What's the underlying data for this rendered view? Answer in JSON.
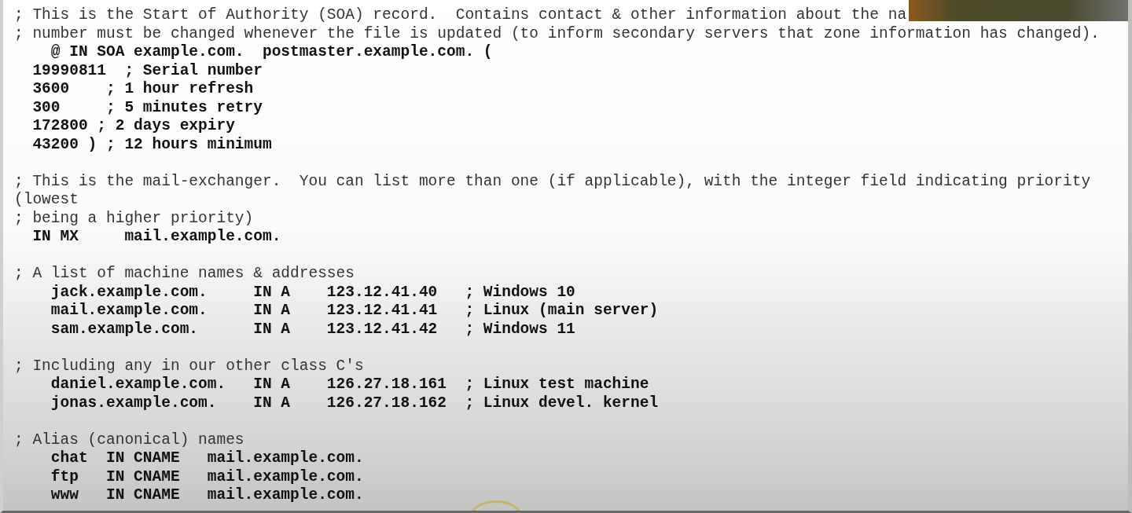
{
  "document": {
    "blocks": [
      {
        "lines": [
          {
            "kind": "comment",
            "text": "; This is the Start of Authority (SOA) record.  Contains contact & other information about the na"
          },
          {
            "kind": "comment",
            "text": "; number must be changed whenever the file is updated (to inform secondary servers that zone information has changed)."
          },
          {
            "kind": "record",
            "text": "    @ IN SOA example.com.  postmaster.example.com. ("
          },
          {
            "kind": "record",
            "text": "  19990811  ; Serial number"
          },
          {
            "kind": "record",
            "text": "  3600    ; 1 hour refresh"
          },
          {
            "kind": "record",
            "text": "  300     ; 5 minutes retry"
          },
          {
            "kind": "record",
            "text": "  172800 ; 2 days expiry"
          },
          {
            "kind": "record",
            "text": "  43200 ) ; 12 hours minimum"
          }
        ]
      },
      {
        "lines": [
          {
            "kind": "comment",
            "text": "; This is the mail-exchanger.  You can list more than one (if applicable), with the integer field indicating priority"
          },
          {
            "kind": "comment",
            "text": "(lowest"
          },
          {
            "kind": "comment",
            "text": "; being a higher priority)"
          },
          {
            "kind": "record",
            "text": "  IN MX     mail.example.com."
          }
        ]
      },
      {
        "lines": [
          {
            "kind": "comment",
            "text": "; A list of machine names & addresses"
          },
          {
            "kind": "record",
            "text": "    jack.example.com.     IN A    123.12.41.40   ; Windows 10"
          },
          {
            "kind": "record",
            "text": "    mail.example.com.     IN A    123.12.41.41   ; Linux (main server)"
          },
          {
            "kind": "record",
            "text": "    sam.example.com.      IN A    123.12.41.42   ; Windows 11"
          }
        ]
      },
      {
        "lines": [
          {
            "kind": "comment",
            "text": "; Including any in our other class C's"
          },
          {
            "kind": "record",
            "text": "    daniel.example.com.   IN A    126.27.18.161  ; Linux test machine"
          },
          {
            "kind": "record",
            "text": "    jonas.example.com.    IN A    126.27.18.162  ; Linux devel. kernel"
          }
        ]
      },
      {
        "lines": [
          {
            "kind": "comment",
            "text": "; Alias (canonical) names"
          },
          {
            "kind": "record",
            "text": "    chat  IN CNAME   mail.example.com."
          },
          {
            "kind": "record",
            "text": "    ftp   IN CNAME   mail.example.com."
          },
          {
            "kind": "record",
            "text": "    www   IN CNAME   mail.example.com."
          }
        ]
      }
    ]
  }
}
